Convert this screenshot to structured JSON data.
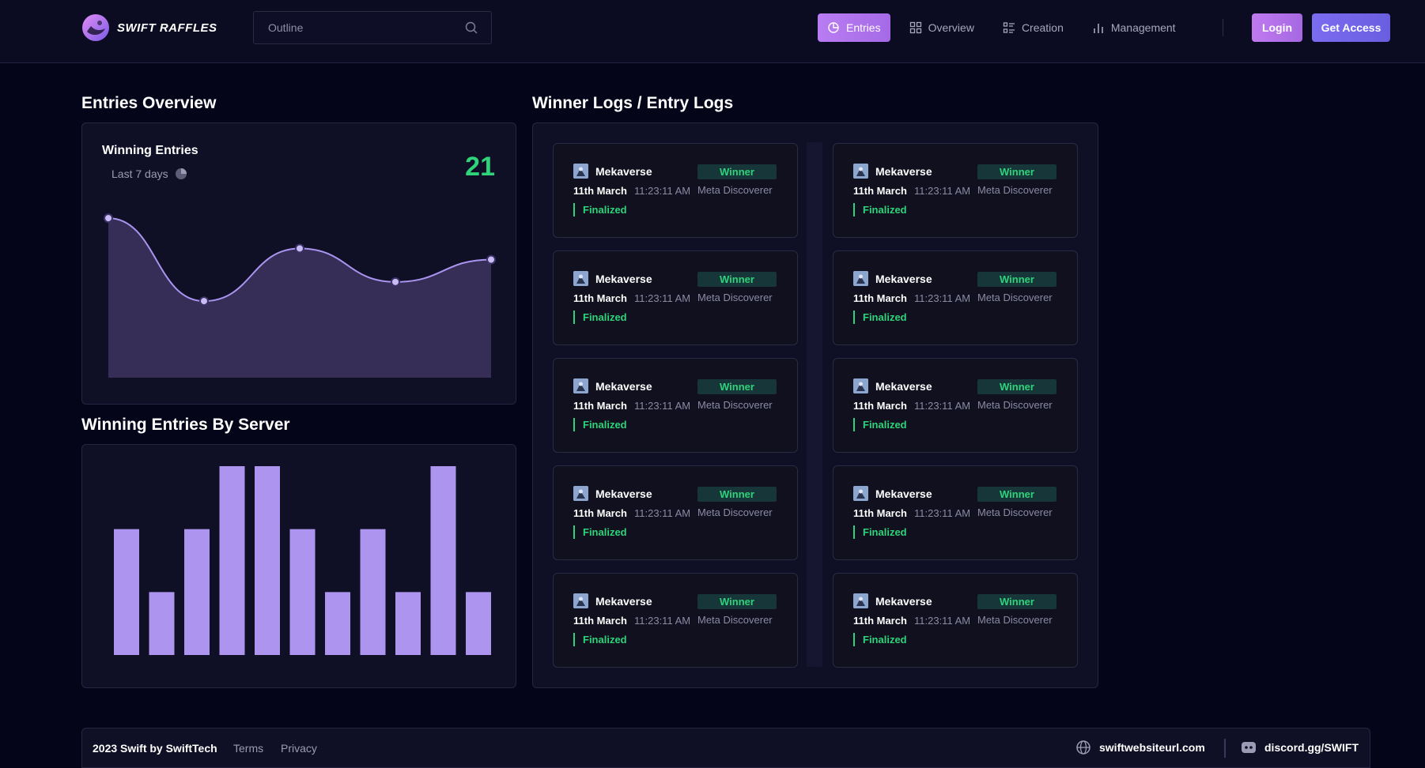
{
  "brand": {
    "name": "SWIFT RAFFLES"
  },
  "search": {
    "placeholder": "Outline"
  },
  "nav": {
    "items": [
      {
        "label": "Entries",
        "icon": "pie-chart-icon",
        "active": true
      },
      {
        "label": "Overview",
        "icon": "grid-icon",
        "active": false
      },
      {
        "label": "Creation",
        "icon": "list-icon",
        "active": false
      },
      {
        "label": "Management",
        "icon": "bar-chart-icon",
        "active": false
      }
    ],
    "login_label": "Login",
    "access_label": "Get Access"
  },
  "entries_overview": {
    "section_title": "Entries Overview",
    "card_title": "Winning Entries",
    "period": "Last 7 days",
    "value": "21"
  },
  "server_section": {
    "section_title": "Winning Entries By Server"
  },
  "logs": {
    "section_title": "Winner Logs / Entry Logs",
    "entries": [
      {
        "project": "Mekaverse",
        "badge": "Winner",
        "date": "11th March",
        "time": "11:23:11 AM",
        "role": "Meta Discoverer",
        "status": "Finalized"
      },
      {
        "project": "Mekaverse",
        "badge": "Winner",
        "date": "11th March",
        "time": "11:23:11 AM",
        "role": "Meta Discoverer",
        "status": "Finalized"
      },
      {
        "project": "Mekaverse",
        "badge": "Winner",
        "date": "11th March",
        "time": "11:23:11 AM",
        "role": "Meta Discoverer",
        "status": "Finalized"
      },
      {
        "project": "Mekaverse",
        "badge": "Winner",
        "date": "11th March",
        "time": "11:23:11 AM",
        "role": "Meta Discoverer",
        "status": "Finalized"
      },
      {
        "project": "Mekaverse",
        "badge": "Winner",
        "date": "11th March",
        "time": "11:23:11 AM",
        "role": "Meta Discoverer",
        "status": "Finalized"
      },
      {
        "project": "Mekaverse",
        "badge": "Winner",
        "date": "11th March",
        "time": "11:23:11 AM",
        "role": "Meta Discoverer",
        "status": "Finalized"
      },
      {
        "project": "Mekaverse",
        "badge": "Winner",
        "date": "11th March",
        "time": "11:23:11 AM",
        "role": "Meta Discoverer",
        "status": "Finalized"
      },
      {
        "project": "Mekaverse",
        "badge": "Winner",
        "date": "11th March",
        "time": "11:23:11 AM",
        "role": "Meta Discoverer",
        "status": "Finalized"
      },
      {
        "project": "Mekaverse",
        "badge": "Winner",
        "date": "11th March",
        "time": "11:23:11 AM",
        "role": "Meta Discoverer",
        "status": "Finalized"
      },
      {
        "project": "Mekaverse",
        "badge": "Winner",
        "date": "11th March",
        "time": "11:23:11 AM",
        "role": "Meta Discoverer",
        "status": "Finalized"
      }
    ]
  },
  "footer": {
    "copyright": "2023 Swift by SwiftTech",
    "terms": "Terms",
    "privacy": "Privacy",
    "website": "swiftwebsiteurl.com",
    "discord": "discord.gg/SWIFT"
  },
  "colors": {
    "accent_purple": "#a56ae6",
    "accent_violet": "#6a5ee0",
    "success_green": "#2fd37a",
    "bar_fill": "#ac94ef",
    "line_stroke": "#a994f0",
    "area_fill": "#3e3461"
  },
  "chart_data": [
    {
      "type": "area",
      "x": [
        1,
        2,
        3,
        4,
        5
      ],
      "values": [
        1.0,
        0.48,
        0.81,
        0.6,
        0.74
      ],
      "ylim": [
        0,
        1.04
      ],
      "grid": false
    },
    {
      "type": "bar",
      "values": [
        2,
        1,
        2,
        3,
        3,
        2,
        1,
        2,
        1,
        3,
        1
      ],
      "ylim": [
        0,
        3
      ],
      "grid": false
    }
  ]
}
